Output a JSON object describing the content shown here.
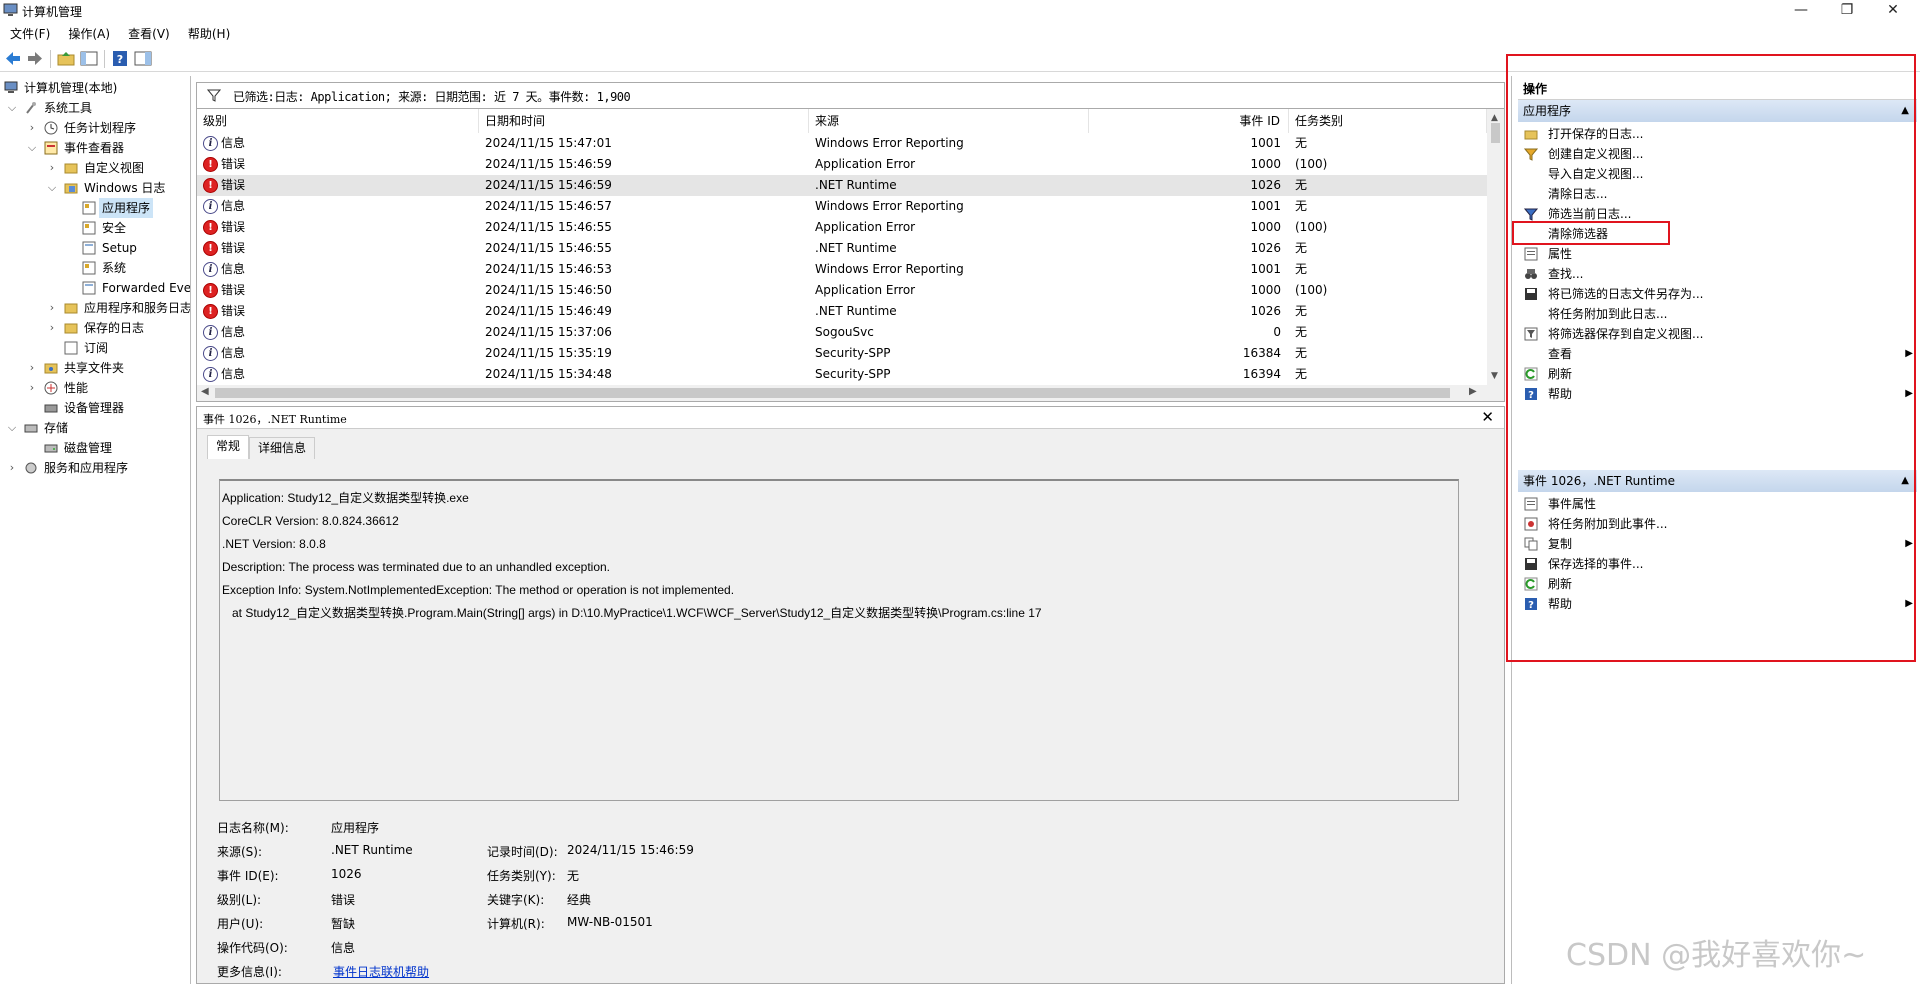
{
  "window": {
    "title": "计算机管理",
    "min": "—",
    "max": "❐",
    "close": "✕"
  },
  "menu": [
    "文件(F)",
    "操作(A)",
    "查看(V)",
    "帮助(H)"
  ],
  "tree": [
    "计算机管理(本地)",
    "系统工具",
    "任务计划程序",
    "事件查看器",
    "自定义视图",
    "Windows 日志",
    "应用程序",
    "安全",
    "Setup",
    "系统",
    "Forwarded Eve",
    "应用程序和服务日志",
    "保存的日志",
    "订阅",
    "共享文件夹",
    "性能",
    "设备管理器",
    "存储",
    "磁盘管理",
    "服务和应用程序"
  ],
  "filter_text": "已筛选:日志: Application; 来源: 日期范围: 近 7 天。事件数: 1,900",
  "columns": [
    "级别",
    "日期和时间",
    "来源",
    "事件 ID",
    "任务类别"
  ],
  "events": [
    {
      "level": "信息",
      "kind": "info",
      "time": "2024/11/15 15:47:01",
      "source": "Windows Error Reporting",
      "id": "1001",
      "cat": "无"
    },
    {
      "level": "错误",
      "kind": "err",
      "time": "2024/11/15 15:46:59",
      "source": "Application Error",
      "id": "1000",
      "cat": "(100)"
    },
    {
      "level": "错误",
      "kind": "err",
      "time": "2024/11/15 15:46:59",
      "source": ".NET Runtime",
      "id": "1026",
      "cat": "无"
    },
    {
      "level": "信息",
      "kind": "info",
      "time": "2024/11/15 15:46:57",
      "source": "Windows Error Reporting",
      "id": "1001",
      "cat": "无"
    },
    {
      "level": "错误",
      "kind": "err",
      "time": "2024/11/15 15:46:55",
      "source": "Application Error",
      "id": "1000",
      "cat": "(100)"
    },
    {
      "level": "错误",
      "kind": "err",
      "time": "2024/11/15 15:46:55",
      "source": ".NET Runtime",
      "id": "1026",
      "cat": "无"
    },
    {
      "level": "信息",
      "kind": "info",
      "time": "2024/11/15 15:46:53",
      "source": "Windows Error Reporting",
      "id": "1001",
      "cat": "无"
    },
    {
      "level": "错误",
      "kind": "err",
      "time": "2024/11/15 15:46:50",
      "source": "Application Error",
      "id": "1000",
      "cat": "(100)"
    },
    {
      "level": "错误",
      "kind": "err",
      "time": "2024/11/15 15:46:49",
      "source": ".NET Runtime",
      "id": "1026",
      "cat": "无"
    },
    {
      "level": "信息",
      "kind": "info",
      "time": "2024/11/15 15:37:06",
      "source": "SogouSvc",
      "id": "0",
      "cat": "无"
    },
    {
      "level": "信息",
      "kind": "info",
      "time": "2024/11/15 15:35:19",
      "source": "Security-SPP",
      "id": "16384",
      "cat": "无"
    },
    {
      "level": "信息",
      "kind": "info",
      "time": "2024/11/15 15:34:48",
      "source": "Security-SPP",
      "id": "16394",
      "cat": "无"
    }
  ],
  "detail": {
    "title": "事件 1026，.NET Runtime",
    "tabs": [
      "常规",
      "详细信息"
    ],
    "message": [
      "Application: Study12_自定义数据类型转换.exe",
      "CoreCLR Version: 8.0.824.36612",
      ".NET Version: 8.0.8",
      "Description: The process was terminated due to an unhandled exception.",
      "Exception Info: System.NotImplementedException: The method or operation is not implemented.",
      "   at Study12_自定义数据类型转换.Program.Main(String[] args) in D:\\10.MyPractice\\1.WCF\\WCF_Server\\Study12_自定义数据类型转换\\Program.cs:line 17"
    ],
    "log_name_label": "日志名称(M):",
    "log_name": "应用程序",
    "source_label": "来源(S):",
    "source": ".NET Runtime",
    "logged_label": "记录时间(D):",
    "logged": "2024/11/15 15:46:59",
    "event_id_label": "事件 ID(E):",
    "event_id": "1026",
    "task_label": "任务类别(Y):",
    "task": "无",
    "level_label": "级别(L):",
    "level": "错误",
    "keywords_label": "关键字(K):",
    "keywords": "经典",
    "user_label": "用户(U):",
    "user": "暂缺",
    "computer_label": "计算机(R):",
    "computer": "MW-NB-01501",
    "opcode_label": "操作代码(O):",
    "opcode": "信息",
    "more_label": "更多信息(I):",
    "more_link": "事件日志联机帮助"
  },
  "actions": {
    "header": "操作",
    "group1": "应用程序",
    "items1": [
      "打开保存的日志...",
      "创建自定义视图...",
      "导入自定义视图...",
      "清除日志...",
      "筛选当前日志...",
      "清除筛选器",
      "属性",
      "查找...",
      "将已筛选的日志文件另存为...",
      "将任务附加到此日志...",
      "将筛选器保存到自定义视图...",
      "查看",
      "刷新",
      "帮助"
    ],
    "group2": "事件 1026，.NET Runtime",
    "items2": [
      "事件属性",
      "将任务附加到此事件...",
      "复制",
      "保存选择的事件...",
      "刷新",
      "帮助"
    ]
  },
  "watermark": "CSDN @我好喜欢你~"
}
